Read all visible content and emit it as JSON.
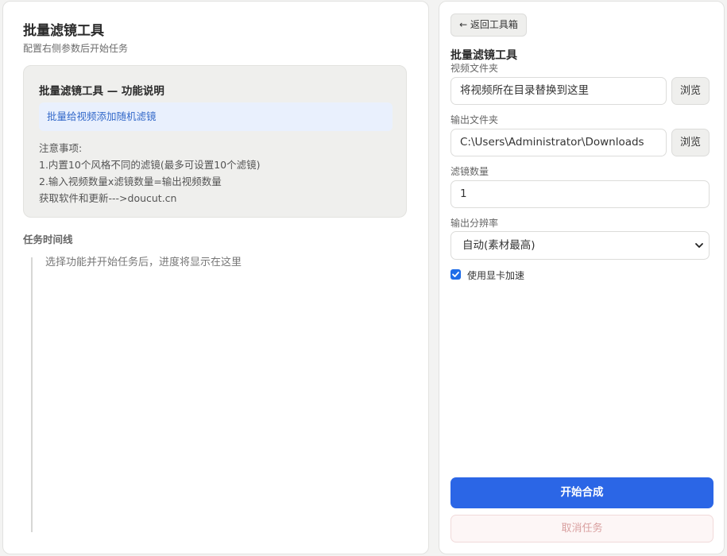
{
  "left": {
    "title": "批量滤镜工具",
    "subtitle": "配置右侧参数后开始任务",
    "info_card": {
      "title": "批量滤镜工具 — 功能说明",
      "highlight": "批量给视频添加随机滤镜",
      "notes": [
        "注意事项:",
        "1.内置10个风格不同的滤镜(最多可设置10个滤镜)",
        "2.输入视频数量x滤镜数量=输出视频数量",
        "获取软件和更新--->doucut.cn"
      ]
    },
    "timeline": {
      "title": "任务时间线",
      "empty_text": "选择功能并开始任务后，进度将显示在这里"
    }
  },
  "right": {
    "back_label": "← 返回工具箱",
    "tool_title": "批量滤镜工具",
    "video_folder": {
      "label": "视频文件夹",
      "value": "将视频所在目录替换到这里",
      "browse_label": "浏览"
    },
    "output_folder": {
      "label": "输出文件夹",
      "value": "C:\\Users\\Administrator\\Downloads",
      "browse_label": "浏览"
    },
    "filter_count": {
      "label": "滤镜数量",
      "value": "1"
    },
    "resolution": {
      "label": "输出分辨率",
      "selected": "自动(素材最高)"
    },
    "gpu": {
      "label": "使用显卡加速",
      "checked": true
    },
    "start_label": "开始合成",
    "cancel_label": "取消任务"
  },
  "colors": {
    "accent": "#2b66e6",
    "highlight_bg": "#e9f0fd",
    "highlight_text": "#3268c9",
    "cancel_text": "#d9a0a0"
  }
}
